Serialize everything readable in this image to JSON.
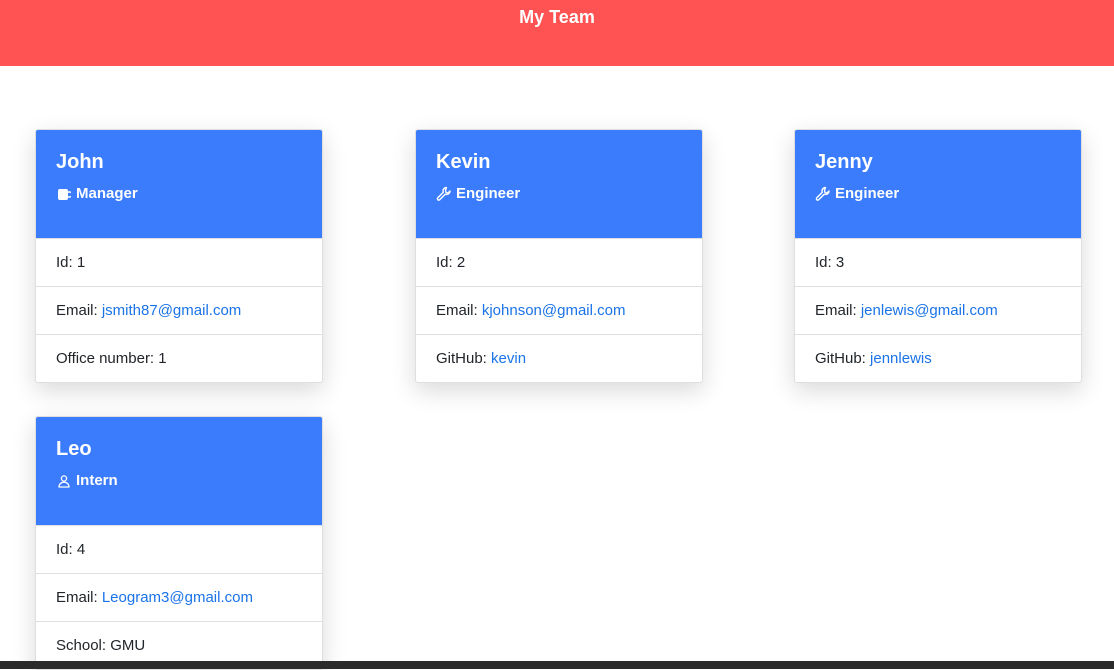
{
  "header": {
    "title": "My Team"
  },
  "colors": {
    "header_bg": "#ff5252",
    "card_header_bg": "#3a7cfc",
    "link": "#1a73e8"
  },
  "cards": [
    {
      "name": "John",
      "role": "Manager",
      "role_icon": "mug-icon",
      "id_label": "Id: ",
      "id": "1",
      "email_label": "Email: ",
      "email": "jsmith87@gmail.com",
      "extra_label": "Office number: ",
      "extra": "1"
    },
    {
      "name": "Kevin",
      "role": "Engineer",
      "role_icon": "wrench-icon",
      "id_label": "Id: ",
      "id": "2",
      "email_label": "Email: ",
      "email": "kjohnson@gmail.com",
      "extra_label": "GitHub: ",
      "extra": "kevin"
    },
    {
      "name": "Jenny",
      "role": "Engineer",
      "role_icon": "wrench-icon",
      "id_label": "Id: ",
      "id": "3",
      "email_label": "Email: ",
      "email": "jenlewis@gmail.com",
      "extra_label": "GitHub: ",
      "extra": "jennlewis"
    },
    {
      "name": "Leo",
      "role": "Intern",
      "role_icon": "person-icon",
      "id_label": "Id: ",
      "id": "4",
      "email_label": "Email: ",
      "email": "Leogram3@gmail.com",
      "extra_label": "School: ",
      "extra": "GMU"
    }
  ]
}
